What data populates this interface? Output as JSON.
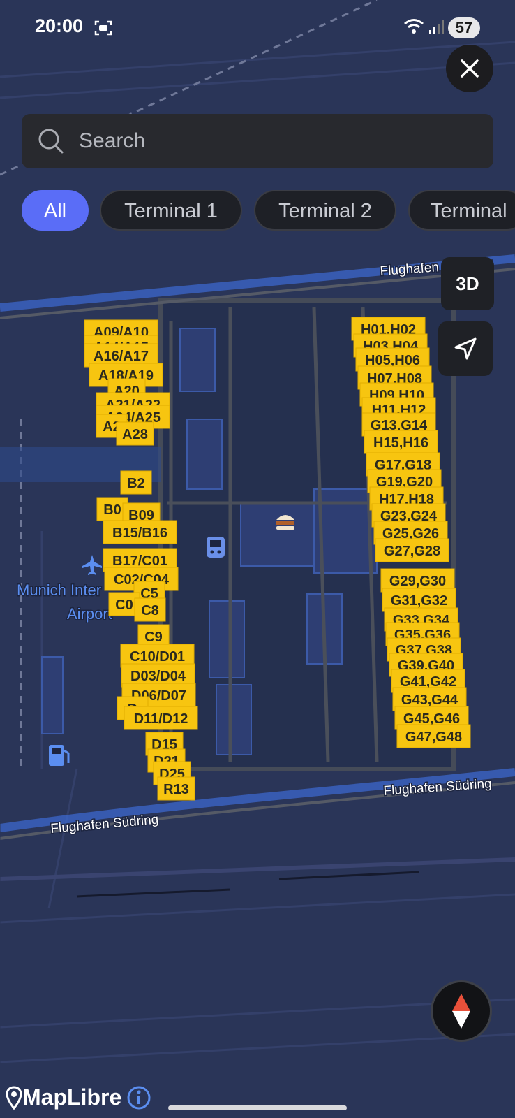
{
  "status_bar": {
    "time": "20:00",
    "battery": "57"
  },
  "search": {
    "placeholder": "Search"
  },
  "filters": [
    {
      "label": "All",
      "active": true
    },
    {
      "label": "Terminal 1",
      "active": false
    },
    {
      "label": "Terminal 2",
      "active": false
    },
    {
      "label": "Terminal",
      "active": false
    }
  ],
  "map_controls": {
    "view_3d_label": "3D"
  },
  "map": {
    "airport_label_line1": "Munich Inter",
    "airport_label_line2": "Airport",
    "road_label_north": "Flughafen Nordring",
    "road_label_south_1": "Flughafen Südring",
    "road_label_south_2": "Flughafen Südring",
    "gate_color": "#f7c510",
    "gates": [
      "A09/A10",
      "A14/A15",
      "A16/A17",
      "A18/A19",
      "A20",
      "A21/A22",
      "A24/A25",
      "A2",
      "A28",
      "B2",
      "B0",
      "B09",
      "B15/B16",
      "B17/C01",
      "C02/C04",
      "C5",
      "C0",
      "C8",
      "C9",
      "C10/D01",
      "D03/D04",
      "D06/D07",
      "D",
      "D11/D12",
      "D15",
      "D21",
      "D25",
      "R13",
      "H01,H02",
      "H03,H04",
      "H05,H06",
      "H07,H08",
      "H09,H10",
      "H11,H12",
      "G13,G14",
      "H15,H16",
      "G17,G18",
      "G19,G20",
      "H17,H18",
      "G23,G24",
      "G25,G26",
      "G27,G28",
      "G29,G30",
      "G31,G32",
      "G33,G34",
      "G35,G36",
      "G37,G38",
      "G39,G40",
      "G41,G42",
      "G43,G44",
      "G45,G46",
      "G47,G48"
    ]
  },
  "attribution": {
    "brand": "MapLibre"
  }
}
